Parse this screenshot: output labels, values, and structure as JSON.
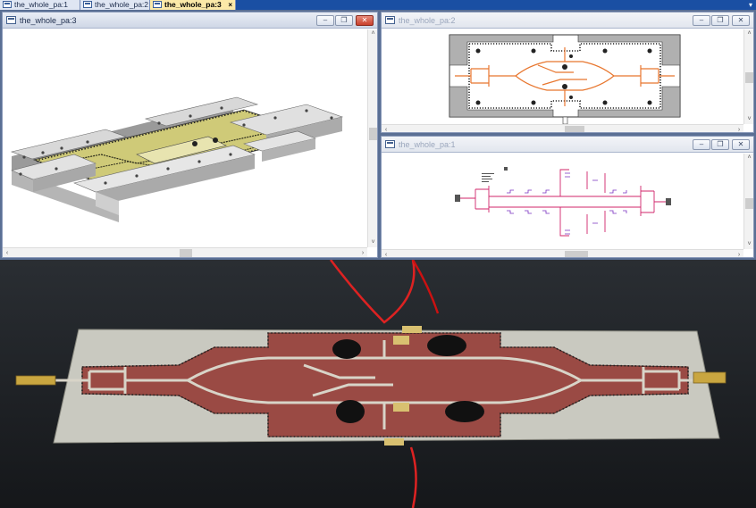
{
  "tabs": [
    {
      "label": "the_whole_pa:1",
      "active": false
    },
    {
      "label": "the_whole_pa:2",
      "active": false
    },
    {
      "label": "the_whole_pa:3",
      "active": true
    }
  ],
  "tab_close_glyph": "×",
  "tab_menu_glyph": "▾",
  "windows": {
    "view3d": {
      "title": "the_whole_pa:3"
    },
    "layout": {
      "title": "the_whole_pa:2"
    },
    "schematic": {
      "title": "the_whole_pa:1"
    }
  },
  "window_buttons": {
    "minimize": "–",
    "restore": "❐",
    "close": "✕"
  },
  "scroll_arrows": {
    "up": "˄",
    "down": "˅",
    "left": "‹",
    "right": "›"
  },
  "colors": {
    "accent_tab": "#fbe9a8",
    "tabbar": "#1a4fa3",
    "workspace": "#5a6f94",
    "board_substrate": "#9a4a44",
    "board_metal": "#c9c9c0",
    "pcb_3d_copper": "#cfca78",
    "layout_traces": "#e8762e",
    "schematic_wires": "#d0246a"
  }
}
